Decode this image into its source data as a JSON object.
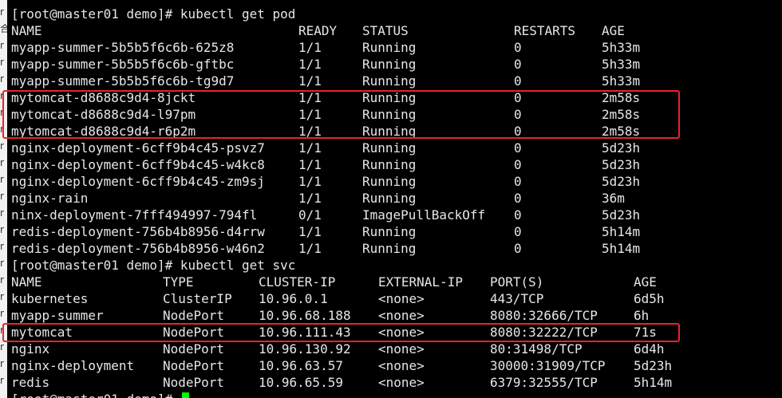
{
  "left_strip": {
    "glyphs": [
      "r",
      "合",
      "r",
      "r",
      "r",
      "r",
      "r",
      "r",
      "r",
      "r",
      "r",
      "r",
      "r",
      "r",
      "r",
      "r",
      "r",
      "r",
      "r",
      "r",
      "r",
      "r",
      "r"
    ]
  },
  "prompt1": "[root@master01 demo]# kubectl get pod",
  "pods": {
    "headers": [
      "NAME",
      "READY",
      "STATUS",
      "RESTARTS",
      "AGE"
    ],
    "rows": [
      [
        "myapp-summer-5b5b5f6c6b-625z8",
        "1/1",
        "Running",
        "0",
        "5h33m"
      ],
      [
        "myapp-summer-5b5b5f6c6b-gftbc",
        "1/1",
        "Running",
        "0",
        "5h33m"
      ],
      [
        "myapp-summer-5b5b5f6c6b-tg9d7",
        "1/1",
        "Running",
        "0",
        "5h33m"
      ],
      [
        "mytomcat-d8688c9d4-8jckt",
        "1/1",
        "Running",
        "0",
        "2m58s"
      ],
      [
        "mytomcat-d8688c9d4-l97pm",
        "1/1",
        "Running",
        "0",
        "2m58s"
      ],
      [
        "mytomcat-d8688c9d4-r6p2m",
        "1/1",
        "Running",
        "0",
        "2m58s"
      ],
      [
        "nginx-deployment-6cff9b4c45-psvz7",
        "1/1",
        "Running",
        "0",
        "5d23h"
      ],
      [
        "nginx-deployment-6cff9b4c45-w4kc8",
        "1/1",
        "Running",
        "0",
        "5d23h"
      ],
      [
        "nginx-deployment-6cff9b4c45-zm9sj",
        "1/1",
        "Running",
        "0",
        "5d23h"
      ],
      [
        "nginx-rain",
        "1/1",
        "Running",
        "0",
        "36m"
      ],
      [
        "ninx-deployment-7fff494997-794fl",
        "0/1",
        "ImagePullBackOff",
        "0",
        "5d23h"
      ],
      [
        "redis-deployment-756b4b8956-d4rrw",
        "1/1",
        "Running",
        "0",
        "5h14m"
      ],
      [
        "redis-deployment-756b4b8956-w46n2",
        "1/1",
        "Running",
        "0",
        "5h14m"
      ]
    ]
  },
  "prompt2": "[root@master01 demo]# kubectl get svc",
  "svcs": {
    "headers": [
      "NAME",
      "TYPE",
      "CLUSTER-IP",
      "EXTERNAL-IP",
      "PORT(S)",
      "AGE"
    ],
    "rows": [
      [
        "kubernetes",
        "ClusterIP",
        "10.96.0.1",
        "<none>",
        "443/TCP",
        "6d5h"
      ],
      [
        "myapp-summer",
        "NodePort",
        "10.96.68.188",
        "<none>",
        "8080:32666/TCP",
        "6h"
      ],
      [
        "mytomcat",
        "NodePort",
        "10.96.111.43",
        "<none>",
        "8080:32222/TCP",
        "71s"
      ],
      [
        "nginx",
        "NodePort",
        "10.96.130.92",
        "<none>",
        "80:31498/TCP",
        "6d4h"
      ],
      [
        "nginx-deployment",
        "NodePort",
        "10.96.63.57",
        "<none>",
        "30000:31909/TCP",
        "5d23h"
      ],
      [
        "redis",
        "NodePort",
        "10.96.65.59",
        "<none>",
        "6379:32555/TCP",
        "5h14m"
      ]
    ]
  },
  "prompt3": "[root@master01 demo]# ",
  "colors": {
    "background": "#000000",
    "text": "#e6e6e6",
    "highlight_box": "#e8242a",
    "cursor": "#00ff00"
  }
}
